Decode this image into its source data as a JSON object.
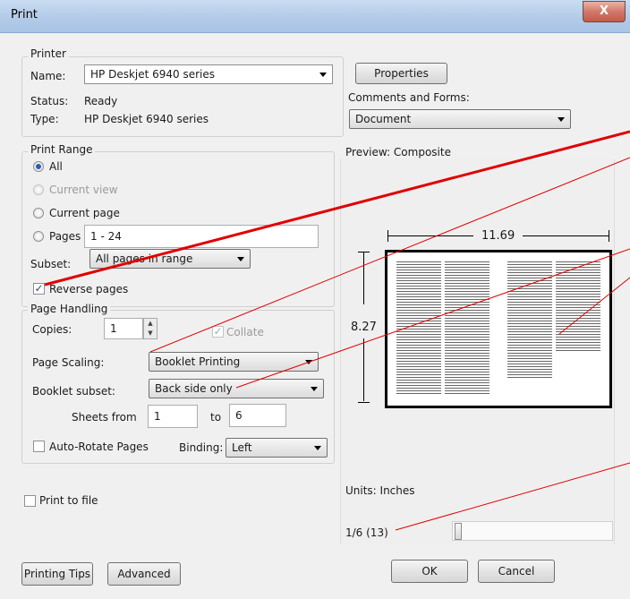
{
  "window": {
    "title": "Print",
    "close_label": "X"
  },
  "printer": {
    "group_label": "Printer",
    "name_label": "Name:",
    "name_value": "HP Deskjet 6940 series",
    "properties_label": "Properties",
    "status_label": "Status:",
    "status_value": "Ready",
    "type_label": "Type:",
    "type_value": "HP Deskjet 6940 series",
    "comments_label": "Comments and Forms:",
    "comments_value": "Document"
  },
  "print_range": {
    "group_label": "Print Range",
    "all_label": "All",
    "current_view_label": "Current view",
    "current_page_label": "Current page",
    "pages_label": "Pages",
    "pages_value": "1 - 24",
    "subset_label": "Subset:",
    "subset_value": "All pages in range",
    "reverse_label": "Reverse pages"
  },
  "page_handling": {
    "group_label": "Page Handling",
    "copies_label": "Copies:",
    "copies_value": "1",
    "collate_label": "Collate",
    "scaling_label": "Page Scaling:",
    "scaling_value": "Booklet Printing",
    "booklet_label": "Booklet subset:",
    "booklet_value": "Back side only",
    "sheets_from_label": "Sheets from",
    "sheets_from_value": "1",
    "to_label": "to",
    "sheets_to_value": "6",
    "autorotate_label": "Auto-Rotate Pages",
    "binding_label": "Binding:",
    "binding_value": "Left"
  },
  "print_to_file_label": "Print to file",
  "preview": {
    "header": "Preview: Composite",
    "width_dim": "11.69",
    "height_dim": "8.27",
    "units": "Units: Inches",
    "page_indicator": "1/6 (13)"
  },
  "buttons": {
    "printing_tips": "Printing Tips",
    "advanced": "Advanced",
    "ok": "OK",
    "cancel": "Cancel"
  },
  "annotation_color": "#e00000"
}
